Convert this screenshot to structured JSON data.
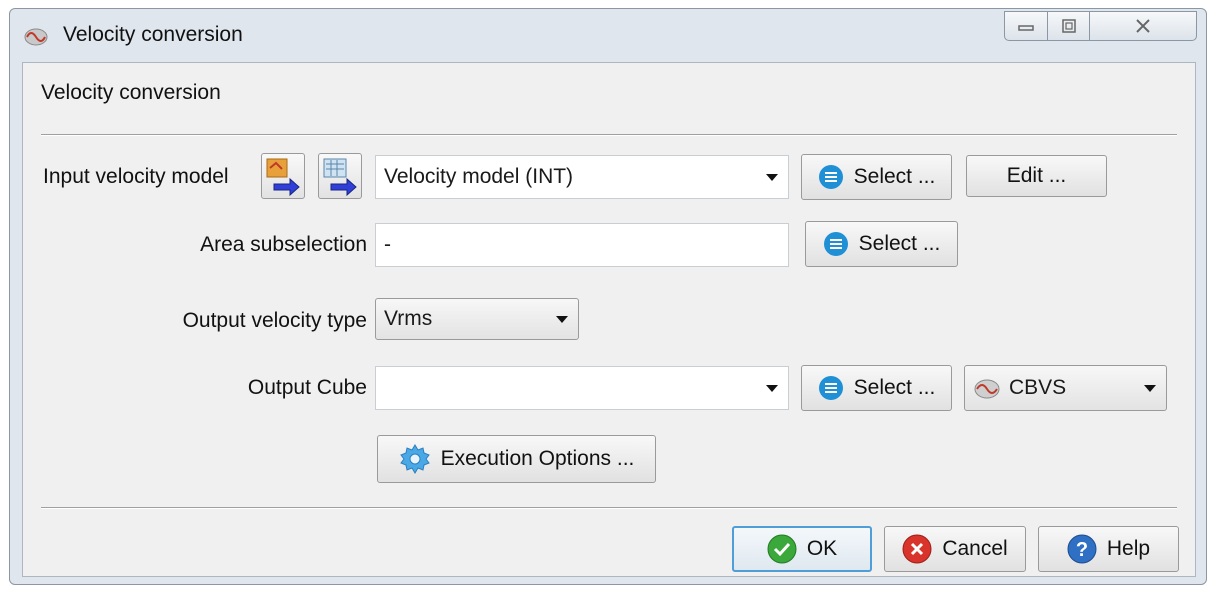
{
  "window": {
    "title": "Velocity conversion",
    "controls": [
      "minimize-icon",
      "maximize-icon",
      "close-icon"
    ],
    "close_glyph": "ᔕ"
  },
  "section_title": "Velocity conversion",
  "input_velocity_model": {
    "label": "Input velocity model",
    "icons": [
      "import-horizon-icon",
      "import-table-icon"
    ],
    "value": "Velocity model (INT)",
    "select_label": "Select ...",
    "edit_label": "Edit ..."
  },
  "area_subselection": {
    "label": "Area subselection",
    "value": "-",
    "select_label": "Select ..."
  },
  "output_velocity_type": {
    "label": "Output velocity type",
    "value": "Vrms"
  },
  "output_cube": {
    "label": "Output Cube",
    "value": "",
    "select_label": "Select ...",
    "format": "CBVS"
  },
  "execution_options_label": "Execution Options ...",
  "footer": {
    "ok_label": "OK",
    "cancel_label": "Cancel",
    "help_label": "Help"
  },
  "colors": {
    "window_frame": "#dfe6ee",
    "client_bg": "#f0f0f0",
    "select_icon": "#1f8fd6",
    "ok_icon": "#3aa83a",
    "cancel_icon": "#d9342b",
    "help_icon": "#2f6fc4",
    "default_button_border": "#4f9ed8"
  }
}
